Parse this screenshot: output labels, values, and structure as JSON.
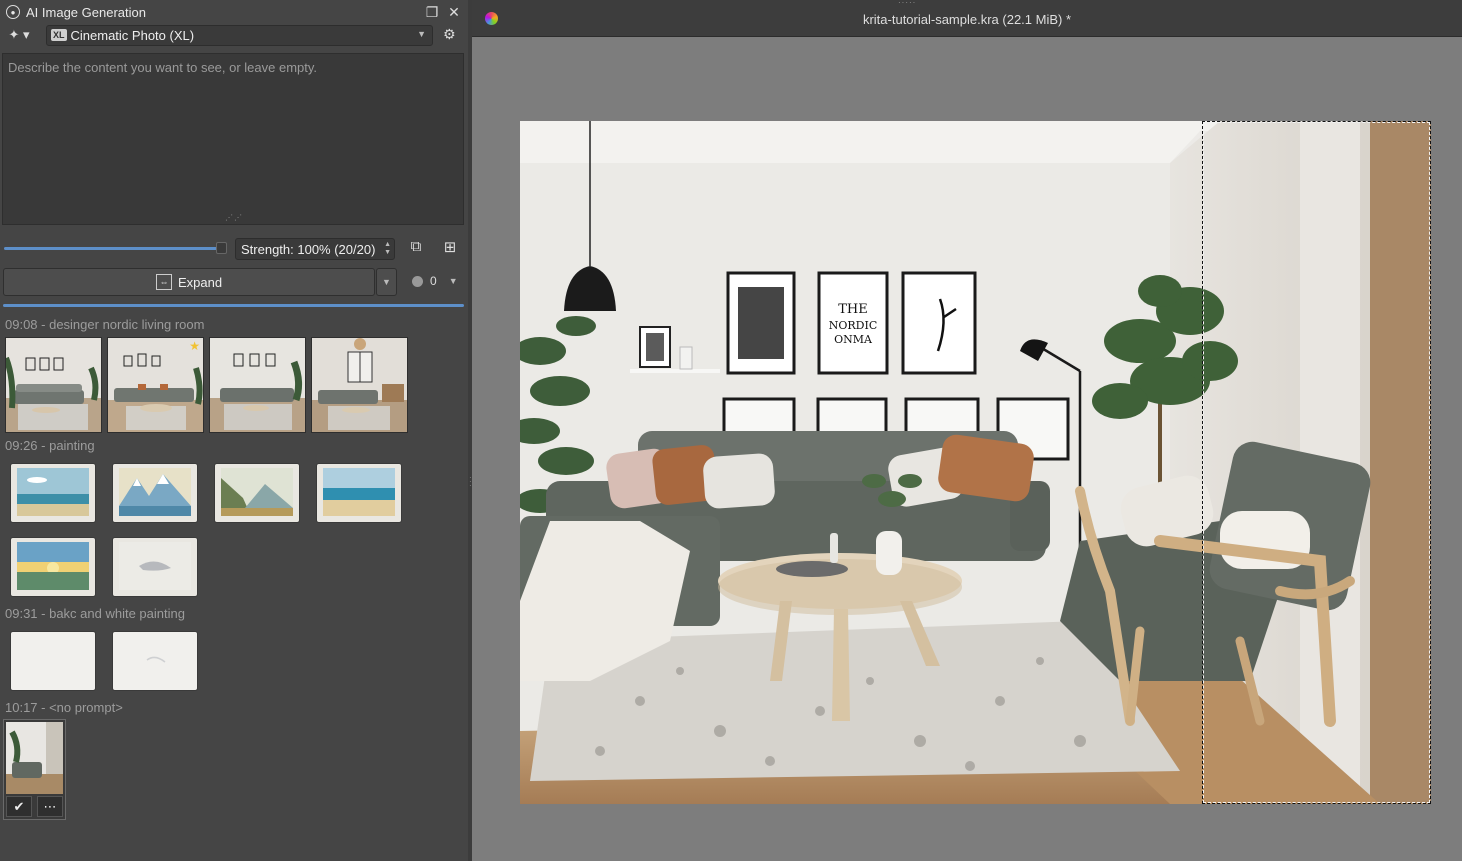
{
  "docker": {
    "title": "AI Image Generation",
    "style_name": "Cinematic Photo (XL)",
    "style_badge": "XL",
    "prompt_placeholder": "Describe the content you want to see, or leave empty.",
    "strength_label": "Strength: 100% (20/20)",
    "strength_fraction": 1.0,
    "expand_label": "Expand",
    "seed_value": "0"
  },
  "history": {
    "groups": [
      {
        "label": "09:08 - desinger nordic living room",
        "count": 4
      },
      {
        "label": "09:26 - painting",
        "count": 6
      },
      {
        "label": "09:31 - bakc and white painting",
        "count": 2
      },
      {
        "label": "10:17 - <no prompt>",
        "count": 1
      }
    ]
  },
  "canvas": {
    "document_title": "krita-tutorial-sample.kra (22.1 MiB) *"
  },
  "colors": {
    "accent": "#5d8fc9",
    "panel": "#454545",
    "canvas_bg": "#7d7d7d",
    "star": "#f1c232"
  }
}
